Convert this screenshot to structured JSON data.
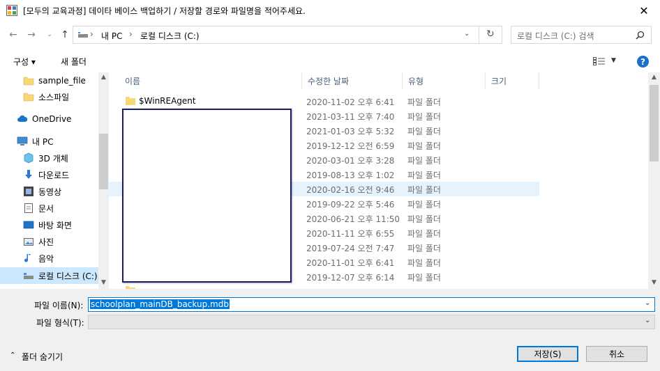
{
  "window": {
    "title": "[모두의 교육과정] 데이타 베이스 백업하기 / 저장할 경로와 파일명을 적어주세요.",
    "close_glyph": "✕"
  },
  "address": {
    "crumbs": [
      "내 PC",
      "로컬 디스크 (C:)"
    ],
    "separator": "›"
  },
  "search": {
    "placeholder": "로컬 디스크 (C:) 검색"
  },
  "toolbar": {
    "organize_label": "구성 ▾",
    "new_folder_label": "새 폴더",
    "help_label": "?"
  },
  "nav": {
    "items": [
      {
        "label": "sample_file"
      },
      {
        "label": "소스파일"
      },
      {
        "label": "OneDrive"
      },
      {
        "label": "내 PC"
      },
      {
        "label": "3D 개체"
      },
      {
        "label": "다운로드"
      },
      {
        "label": "동영상"
      },
      {
        "label": "문서"
      },
      {
        "label": "바탕 화면"
      },
      {
        "label": "사진"
      },
      {
        "label": "음악"
      },
      {
        "label": "로컬 디스크 (C:)"
      }
    ]
  },
  "columns": {
    "name": "이름",
    "modified": "수정한 날짜",
    "type": "유형",
    "size": "크기"
  },
  "rows": [
    {
      "name": "$WinREAgent",
      "date": "2020-11-02 오후 6:41",
      "type": "파일 폴더"
    },
    {
      "name": "",
      "date": "2021-03-11 오후 7:40",
      "type": "파일 폴더"
    },
    {
      "name": "",
      "date": "2021-01-03 오후 5:32",
      "type": "파일 폴더"
    },
    {
      "name": "",
      "date": "2019-12-12 오전 6:59",
      "type": "파일 폴더"
    },
    {
      "name": "",
      "date": "2020-03-01 오후 3:28",
      "type": "파일 폴더"
    },
    {
      "name": "",
      "date": "2019-08-13 오후 1:02",
      "type": "파일 폴더"
    },
    {
      "name": "",
      "date": "2020-02-16 오전 9:46",
      "type": "파일 폴더"
    },
    {
      "name": "",
      "date": "2019-09-22 오후 5:46",
      "type": "파일 폴더"
    },
    {
      "name": "",
      "date": "2020-06-21 오후 11:50",
      "type": "파일 폴더"
    },
    {
      "name": "",
      "date": "2020-11-11 오후 6:55",
      "type": "파일 폴더"
    },
    {
      "name": "",
      "date": "2019-07-24 오전 7:47",
      "type": "파일 폴더"
    },
    {
      "name": "",
      "date": "2020-11-01 오후 6:41",
      "type": "파일 폴더"
    },
    {
      "name": "",
      "date": "2019-12-07 오후 6:14",
      "type": "파일 폴더"
    }
  ],
  "form": {
    "filename_label": "파일 이름(N):",
    "filename_value": "schoolplan_mainDB_backup.mdb",
    "filetype_label": "파일 형식(T):",
    "hide_folders_label": "폴더 숨기기",
    "save_label": "저장(S)",
    "cancel_label": "취소"
  },
  "colors": {
    "accent": "#0078d7",
    "selection": "#cce8ff",
    "hover": "#e5f3ff",
    "folder": "#f8d775"
  }
}
